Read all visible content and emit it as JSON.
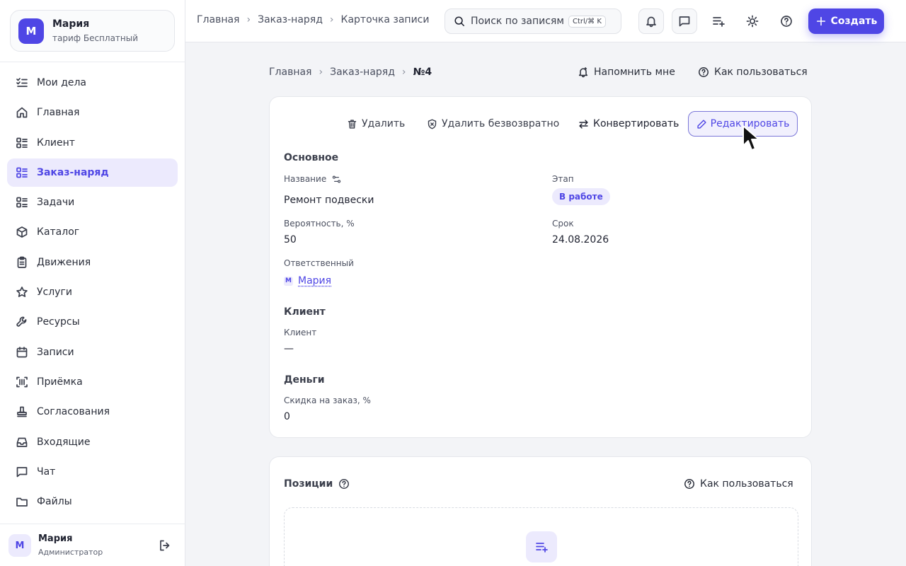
{
  "account": {
    "initial": "М",
    "name": "Мария",
    "plan": "тариф Бесплатный"
  },
  "sidebar": {
    "items": [
      {
        "label": "Мои дела",
        "icon": "checklist-icon"
      },
      {
        "label": "Главная",
        "icon": "home-icon"
      },
      {
        "label": "Клиент",
        "icon": "list-icon"
      },
      {
        "label": "Заказ-наряд",
        "icon": "list-icon",
        "active": true
      },
      {
        "label": "Задачи",
        "icon": "list-icon"
      },
      {
        "label": "Каталог",
        "icon": "box-icon"
      },
      {
        "label": "Движения",
        "icon": "clipboard-icon"
      },
      {
        "label": "Услуги",
        "icon": "star-icon"
      },
      {
        "label": "Ресурсы",
        "icon": "wrench-icon"
      },
      {
        "label": "Записи",
        "icon": "calendar-icon"
      },
      {
        "label": "Приёмка",
        "icon": "barcode-icon"
      },
      {
        "label": "Согласования",
        "icon": "stamp-icon"
      },
      {
        "label": "Входящие",
        "icon": "inbox-icon"
      },
      {
        "label": "Чат",
        "icon": "chat-icon"
      },
      {
        "label": "Файлы",
        "icon": "folder-icon"
      }
    ]
  },
  "footer_user": {
    "initial": "М",
    "name": "Мария",
    "role": "Администратор"
  },
  "topbar": {
    "breadcrumb": [
      "Главная",
      "Заказ-наряд",
      "Карточка записи"
    ],
    "search_placeholder": "Поиск по записям",
    "search_shortcut": "Ctrl/⌘ K",
    "create_label": "Создать"
  },
  "page": {
    "breadcrumb": [
      "Главная",
      "Заказ-наряд"
    ],
    "record_number": "№4",
    "remind_label": "Напомнить мне",
    "help_label": "Как пользоваться"
  },
  "actions": {
    "delete": "Удалить",
    "delete_forever": "Удалить безвозвратно",
    "convert": "Конвертировать",
    "edit": "Редактировать"
  },
  "record": {
    "section_main": "Основное",
    "name_label": "Название",
    "name_value": "Ремонт подвески",
    "stage_label": "Этап",
    "stage_value": "В работе",
    "probability_label": "Вероятность, %",
    "probability_value": "50",
    "deadline_label": "Срок",
    "deadline_value": "24.08.2026",
    "responsible_label": "Ответственный",
    "responsible_initial": "М",
    "responsible_name": "Мария",
    "section_client": "Клиент",
    "client_label": "Клиент",
    "client_value": "—",
    "section_money": "Деньги",
    "discount_label": "Скидка на заказ, %",
    "discount_value": "0"
  },
  "positions": {
    "title": "Позиции",
    "help_label": "Как пользоваться"
  },
  "colors": {
    "accent": "#4f46e5",
    "accent_light": "#eceafd",
    "background": "#f3f4f7"
  }
}
